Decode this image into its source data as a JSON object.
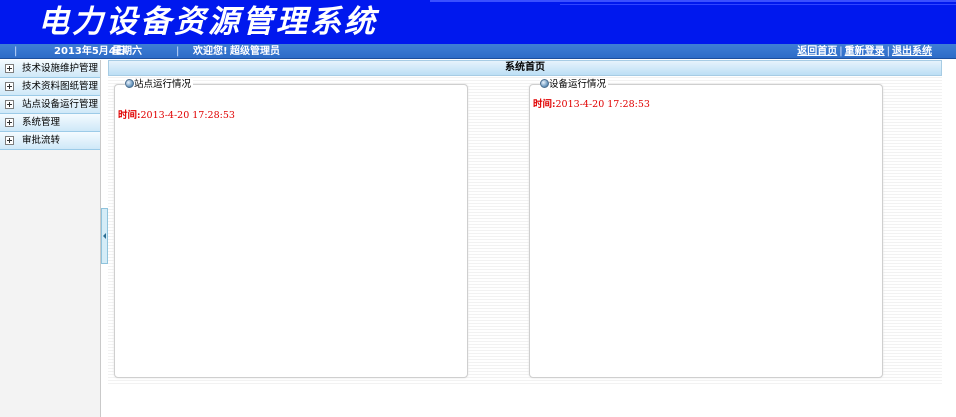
{
  "header": {
    "app_title": "电力设备资源管理系统",
    "date": "2013年5月4日",
    "weekday": "星期六",
    "welcome": "欢迎您!",
    "username": "超级管理员",
    "links": {
      "home": "返回首页",
      "relogin": "重新登录",
      "logout": "退出系统"
    }
  },
  "sidebar": {
    "items": [
      {
        "label": "技术设施维护管理"
      },
      {
        "label": "技术资料图纸管理"
      },
      {
        "label": "站点设备运行管理"
      },
      {
        "label": "系统管理"
      },
      {
        "label": "审批流转"
      }
    ]
  },
  "main": {
    "title": "系统首页",
    "panels": [
      {
        "title": "站点运行情况",
        "time_label": "时间:",
        "time_value": "2013-4-20 17:28:53"
      },
      {
        "title": "设备运行情况",
        "time_label": "时间:",
        "time_value": "2013-4-20 17:28:53"
      }
    ]
  },
  "colors": {
    "banner": "#0018ee",
    "infobar": "#2d6cc8",
    "time_text": "#e00000"
  }
}
